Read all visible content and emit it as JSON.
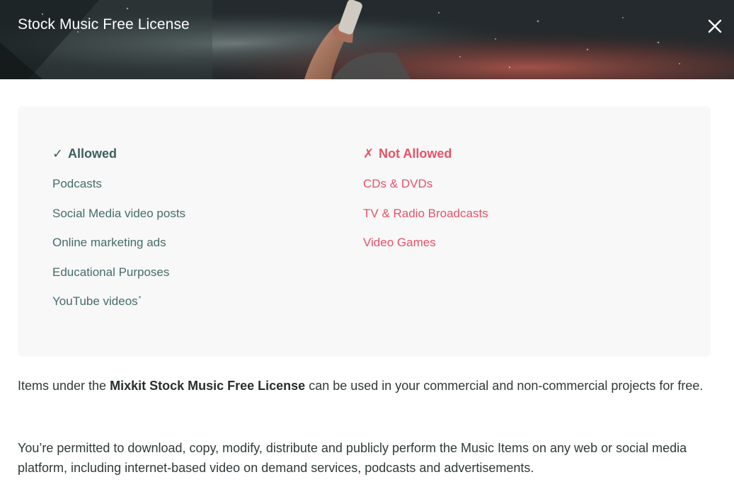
{
  "modal": {
    "title": "Stock Music Free License",
    "close_icon": "close-icon"
  },
  "colors": {
    "allowed": "#3d5f5e",
    "not_allowed": "#e75268",
    "card_background": "#f8f8f8",
    "body_text": "#2f3a3a"
  },
  "allowed": {
    "icon": "checkmark-icon",
    "mark": "✓",
    "heading": "Allowed",
    "items": [
      {
        "label": "Podcasts"
      },
      {
        "label": "Social Media video posts"
      },
      {
        "label": "Online marketing ads"
      },
      {
        "label": "Educational Purposes"
      },
      {
        "label": "YouTube videos",
        "footnote": "*"
      }
    ]
  },
  "not_allowed": {
    "icon": "cross-icon",
    "mark": "✗",
    "heading": "Not Allowed",
    "items": [
      {
        "label": "CDs & DVDs"
      },
      {
        "label": "TV & Radio Broadcasts"
      },
      {
        "label": "Video Games"
      }
    ]
  },
  "paragraphs": {
    "p1": {
      "before": "Items under the ",
      "strong": "Mixkit Stock Music Free License",
      "after": " can be used in your commercial and non-commercial projects for free."
    },
    "p2": "You’re permitted to download, copy, modify, distribute and publicly perform the Music Items on any web or social media platform, including internet-based video on demand services, podcasts and advertisements."
  }
}
